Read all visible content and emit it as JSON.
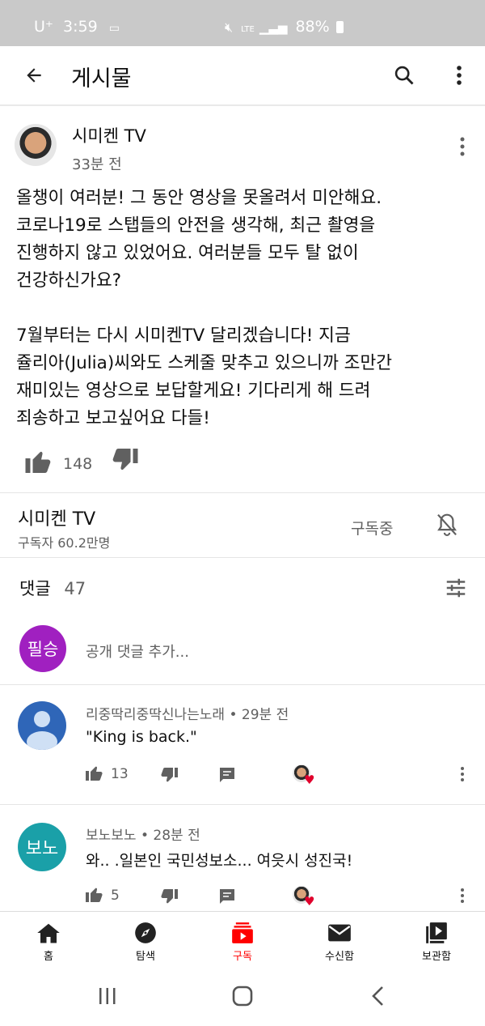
{
  "status": {
    "carrier": "U⁺",
    "time": "3:59",
    "network": "LTE",
    "battery": "88%"
  },
  "header": {
    "title": "게시물"
  },
  "post": {
    "channel": "시미켄 TV",
    "time": "33분 전",
    "text": "올챙이 여러분! 그 동안 영상을 못올려서 미안해요.\n코로나19로 스탭들의 안전을 생각해, 최근 촬영을\n진행하지 않고 있었어요. 여러분들 모두 탈 없이\n건강하신가요?\n\n7월부터는 다시 시미켄TV 달리겠습니다! 지금\n쥴리아(Julia)씨와도 스케줄 맞추고 있으니까 조만간\n재미있는 영상으로 보답할게요! 기다리게 해 드려\n죄송하고 보고싶어요 다들!",
    "likes": "148"
  },
  "channel_bar": {
    "name": "시미켄 TV",
    "subscribers": "구독자 60.2만명",
    "subscribed_label": "구독중"
  },
  "comments_header": {
    "label": "댓글",
    "count": "47"
  },
  "add_comment": {
    "avatar_text": "필승",
    "placeholder": "공개 댓글 추가..."
  },
  "comments": [
    {
      "author": "리중딱리중딱신나는노래",
      "time": "29분 전",
      "text": "\"King is back.\"",
      "likes": "13"
    },
    {
      "author": "보노보노",
      "avatar_text": "보노",
      "time": "28분 전",
      "text": "와.. .일본인 국민성보소... 여읏시 성진국!",
      "likes": "5"
    }
  ],
  "bottom_nav": [
    {
      "label": "홈",
      "icon": "home-icon"
    },
    {
      "label": "탐색",
      "icon": "explore-icon"
    },
    {
      "label": "구독",
      "icon": "subscriptions-icon"
    },
    {
      "label": "수신함",
      "icon": "inbox-icon"
    },
    {
      "label": "보관함",
      "icon": "library-icon"
    }
  ],
  "colors": {
    "accent": "#ff0000",
    "add_avatar": "#a020c0",
    "bono_avatar": "#1aa0a8",
    "user_avatar": "#2f66b8"
  }
}
